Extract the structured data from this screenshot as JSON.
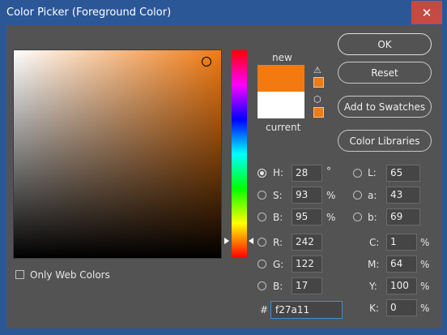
{
  "window": {
    "title": "Color Picker (Foreground Color)",
    "close_glyph": "✕"
  },
  "colors": {
    "new": "#f27a11",
    "current": "#ffffff",
    "accent": "#3c8fd6"
  },
  "labels": {
    "new": "new",
    "current": "current",
    "only_web_colors": "Only Web Colors",
    "hash": "#"
  },
  "icons": {
    "warning": "⚠",
    "cube": "⬡"
  },
  "buttons": {
    "ok": "OK",
    "reset": "Reset",
    "add_to_swatches": "Add to Swatches",
    "color_libraries": "Color Libraries"
  },
  "hsb": {
    "h": {
      "label": "H:",
      "value": "28",
      "unit": "°"
    },
    "s": {
      "label": "S:",
      "value": "93",
      "unit": "%"
    },
    "b": {
      "label": "B:",
      "value": "95",
      "unit": "%"
    }
  },
  "rgb": {
    "r": {
      "label": "R:",
      "value": "242"
    },
    "g": {
      "label": "G:",
      "value": "122"
    },
    "b": {
      "label": "B:",
      "value": "17"
    }
  },
  "lab": {
    "l": {
      "label": "L:",
      "value": "65"
    },
    "a": {
      "label": "a:",
      "value": "43"
    },
    "b": {
      "label": "b:",
      "value": "69"
    }
  },
  "cmyk": {
    "c": {
      "label": "C:",
      "value": "1",
      "unit": "%"
    },
    "m": {
      "label": "M:",
      "value": "64",
      "unit": "%"
    },
    "y": {
      "label": "Y:",
      "value": "100",
      "unit": "%"
    },
    "k": {
      "label": "K:",
      "value": "0",
      "unit": "%"
    }
  },
  "hex": "f27a11"
}
